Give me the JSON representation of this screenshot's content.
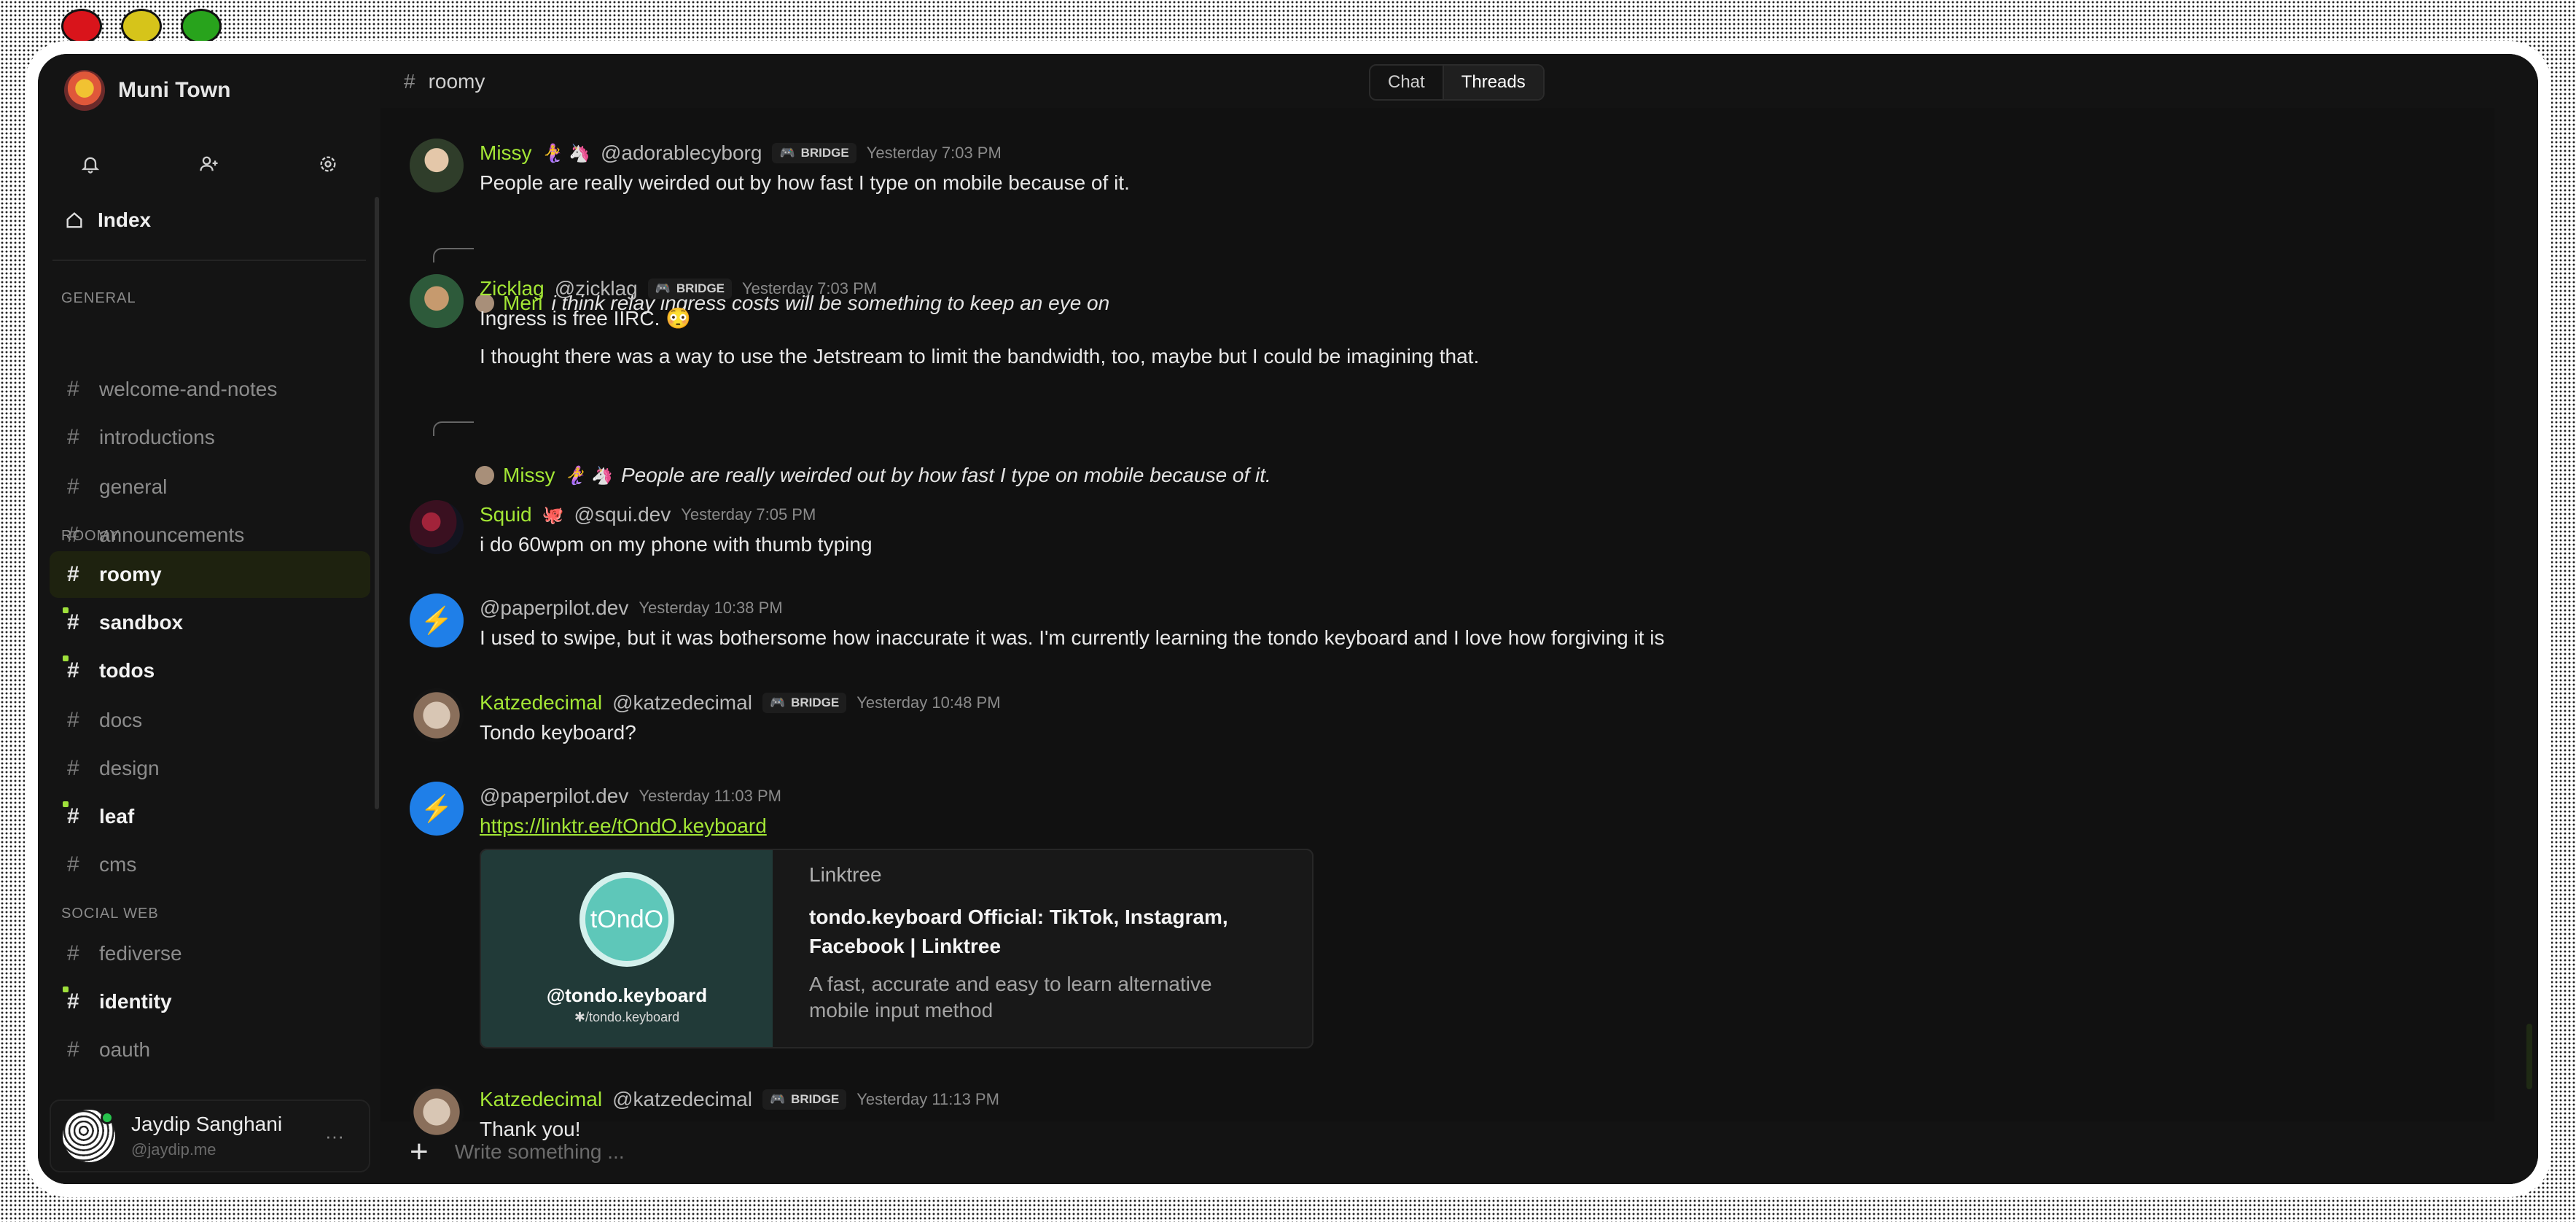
{
  "space": {
    "name": "Muni Town"
  },
  "sidebar": {
    "index_label": "Index",
    "sections": [
      {
        "title": "GENERAL",
        "channels": [
          {
            "name": "welcome-and-notes",
            "unread": false
          },
          {
            "name": "introductions",
            "unread": false
          },
          {
            "name": "general",
            "unread": false
          },
          {
            "name": "announcements",
            "unread": false
          }
        ]
      },
      {
        "title": "ROOMY",
        "channels": [
          {
            "name": "roomy",
            "active": true
          },
          {
            "name": "sandbox",
            "unread": true
          },
          {
            "name": "todos",
            "unread": true
          },
          {
            "name": "docs",
            "unread": false
          },
          {
            "name": "design",
            "unread": false
          },
          {
            "name": "leaf",
            "unread": true
          },
          {
            "name": "cms",
            "unread": false
          }
        ]
      },
      {
        "title": "SOCIAL WEB",
        "channels": [
          {
            "name": "fediverse",
            "unread": false
          },
          {
            "name": "identity",
            "unread": true
          },
          {
            "name": "oauth",
            "unread": false
          }
        ]
      }
    ],
    "user": {
      "name": "Jaydip Sanghani",
      "handle": "@jaydip.me",
      "more": "···"
    }
  },
  "header": {
    "room": "roomy",
    "tabs": [
      {
        "label": "Chat"
      },
      {
        "label": "Threads"
      }
    ]
  },
  "bridge_label": "BRIDGE",
  "messages": [
    {
      "name": "Missy",
      "emoji": "🧜‍♀️ 🦄",
      "handle": "@adorablecyborg",
      "bridge": true,
      "time": "Yesterday 7:03 PM",
      "text": "People are really weirded out by how fast I type on mobile because of it."
    },
    {
      "reply_to": {
        "name": "Meri",
        "text": "i think relay ingress costs will be something to keep an eye on"
      },
      "name": "Zicklag",
      "handle": "@zicklag",
      "bridge": true,
      "time": "Yesterday 7:03 PM",
      "text": "Ingress is free IIRC. 😳",
      "text2": "I thought there was a way to use the Jetstream to limit the bandwidth, too, maybe but I could be imagining that."
    },
    {
      "reply_to": {
        "name": "Missy",
        "emoji": "🧜‍♀️ 🦄",
        "text": "People are really weirded out by how fast I type on mobile because of it."
      },
      "name": "Squid",
      "emoji": "🐙",
      "handle": "@squi.dev",
      "bridge": false,
      "time": "Yesterday 7:05 PM",
      "text": "i do 60wpm on my phone with thumb typing"
    },
    {
      "name": "",
      "handle": "@paperpilot.dev",
      "bridge": false,
      "time": "Yesterday 10:38 PM",
      "text": "I used to swipe, but it was bothersome how inaccurate it was. I'm currently learning the tondo keyboard and I love how forgiving it is"
    },
    {
      "name": "Katzedecimal",
      "handle": "@katzedecimal",
      "bridge": true,
      "time": "Yesterday 10:48 PM",
      "text": "Tondo keyboard?"
    },
    {
      "name": "",
      "handle": "@paperpilot.dev",
      "bridge": false,
      "time": "Yesterday 11:03 PM",
      "link": "https://linktr.ee/tOndO.keyboard",
      "card": {
        "logo_text": "tOndO",
        "image_handle": "@tondo.keyboard",
        "image_sub": "✱/tondo.keyboard",
        "site": "Linktree",
        "title": "tondo.keyboard Official: TikTok, Instagram, Facebook | Linktree",
        "description": "A fast, accurate and easy to learn alternative mobile input method"
      }
    },
    {
      "name": "Katzedecimal",
      "handle": "@katzedecimal",
      "bridge": true,
      "time": "Yesterday 11:13 PM",
      "text": "Thank you!"
    }
  ],
  "composer": {
    "placeholder": "Write something ..."
  },
  "colors": {
    "accent": "#a3e635",
    "background": "#131313",
    "pilot_avatar": "#1f7fe8"
  },
  "icons": [
    "bell-icon",
    "add-user-icon",
    "gear-icon",
    "home-icon",
    "hash-icon",
    "discord-icon",
    "bolt-icon",
    "plus-icon"
  ]
}
